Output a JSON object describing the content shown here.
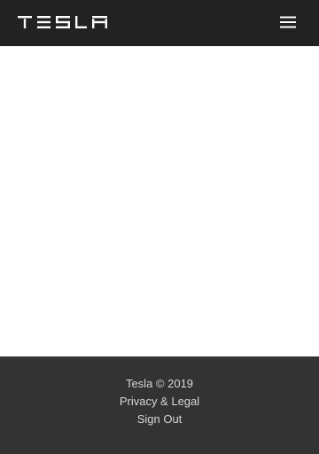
{
  "header": {
    "brand": "TESLA",
    "logo_color": "#ffffff",
    "menu_icon": "hamburger-menu-icon"
  },
  "footer": {
    "copyright": "Tesla © 2019",
    "privacy_label": "Privacy & Legal",
    "signout_label": "Sign Out"
  },
  "colors": {
    "header_bg": "#222222",
    "footer_bg": "#333333",
    "footer_text": "#d6d6d6",
    "page_bg": "#ffffff"
  }
}
